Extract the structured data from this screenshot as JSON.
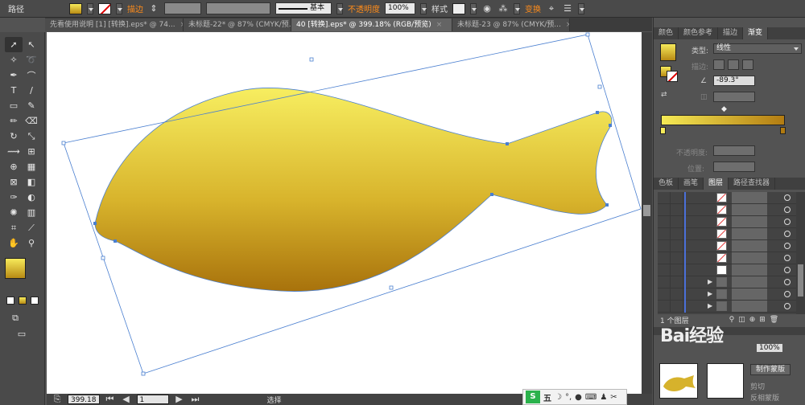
{
  "control_bar": {
    "object_label": "路径",
    "stroke_label": "描边",
    "stroke_style": "基本",
    "opacity_label": "不透明度",
    "opacity_value": "100%",
    "style_label": "样式",
    "transform_label": "变换"
  },
  "tabs": [
    {
      "label": "无标题-22* @ 87% (CMYK/预..."
    },
    {
      "label": "先看使用说明 [1] [转换].eps* @ 74..."
    },
    {
      "label": "未标题-22* @ 87% (CMYK/预..."
    },
    {
      "label": "40 [转换].eps* @ 399.18% (RGB/预览)"
    },
    {
      "label": "未标题-23 @ 87% (CMYK/预..."
    }
  ],
  "tools": [
    {
      "icon": "selection-arrow-icon",
      "glyph": "➚"
    },
    {
      "icon": "direct-selection-icon",
      "glyph": "↖"
    },
    {
      "icon": "magic-wand-icon",
      "glyph": "✧"
    },
    {
      "icon": "lasso-icon",
      "glyph": "➰"
    },
    {
      "icon": "pen-icon",
      "glyph": "✒"
    },
    {
      "icon": "curvature-icon",
      "glyph": "⌒"
    },
    {
      "icon": "type-icon",
      "glyph": "T"
    },
    {
      "icon": "line-icon",
      "glyph": "∕"
    },
    {
      "icon": "rectangle-icon",
      "glyph": "▭"
    },
    {
      "icon": "paintbrush-icon",
      "glyph": "✎"
    },
    {
      "icon": "pencil-icon",
      "glyph": "✏"
    },
    {
      "icon": "eraser-icon",
      "glyph": "⌫"
    },
    {
      "icon": "rotate-icon",
      "glyph": "↻"
    },
    {
      "icon": "scale-icon",
      "glyph": "⤡"
    },
    {
      "icon": "width-icon",
      "glyph": "⟿"
    },
    {
      "icon": "free-transform-icon",
      "glyph": "⊞"
    },
    {
      "icon": "shape-builder-icon",
      "glyph": "⊕"
    },
    {
      "icon": "perspective-grid-icon",
      "glyph": "▦"
    },
    {
      "icon": "mesh-icon",
      "glyph": "⊠"
    },
    {
      "icon": "gradient-icon",
      "glyph": "◧"
    },
    {
      "icon": "eyedropper-icon",
      "glyph": "✑"
    },
    {
      "icon": "blend-icon",
      "glyph": "◐"
    },
    {
      "icon": "symbol-sprayer-icon",
      "glyph": "✺"
    },
    {
      "icon": "column-graph-icon",
      "glyph": "▥"
    },
    {
      "icon": "artboard-icon",
      "glyph": "⌗"
    },
    {
      "icon": "slice-icon",
      "glyph": "⟋"
    },
    {
      "icon": "hand-icon",
      "glyph": "✋"
    },
    {
      "icon": "zoom-icon",
      "glyph": "⚲"
    }
  ],
  "panel": {
    "gradient_tabs": [
      "颜色",
      "颜色参考",
      "描边",
      "渐变"
    ],
    "type_label": "类型:",
    "type_value": "线性",
    "stroke_label": "描边:",
    "angle_value": "-89.3°",
    "opacity_label": "不透明度:",
    "location_label": "位置:",
    "layers_tabs": [
      "色板",
      "画笔",
      "图层",
      "路径查找器"
    ],
    "layers_count_label": "1 个图层",
    "make_mask_label": "制作蒙版",
    "opacity_pct": "100%",
    "clip_label": "剪切",
    "invert_label": "反相蒙版"
  },
  "status": {
    "zoom": "399.18",
    "artboard": "1",
    "tool": "选择"
  },
  "ime": {
    "logo": "S",
    "mode": "五"
  },
  "watermark": "Bai经验",
  "colors": {
    "gradient_start": "#f6ec5c",
    "gradient_end": "#b07a10",
    "selection": "#4a7fd0"
  }
}
